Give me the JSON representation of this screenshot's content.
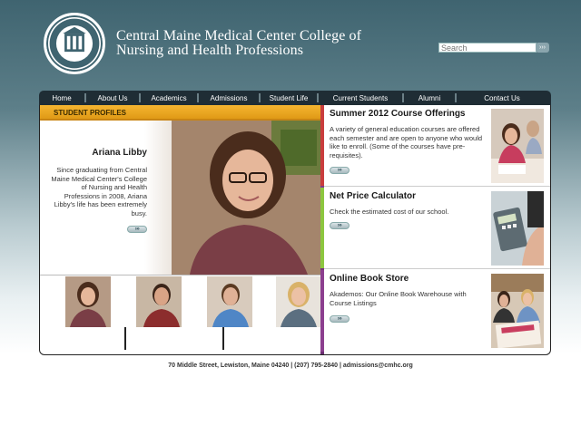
{
  "header": {
    "title_line1": "Central Maine Medical Center College of",
    "title_line2": "Nursing and Health Professions",
    "search": {
      "placeholder": "Search",
      "go_label": "›››"
    }
  },
  "nav": {
    "items": [
      "Home",
      "About Us",
      "Academics",
      "Admissions",
      "Student Life",
      "Current Students",
      "Alumni",
      "Contact Us"
    ]
  },
  "profiles": {
    "heading": "STUDENT PROFILES",
    "featured": {
      "name": "Ariana Libby",
      "text": "Since graduating from Central Maine Medical Center's College of Nursing and Health Professions in 2008, Ariana Libby's life has been extremely busy.",
      "more_label": "›››"
    }
  },
  "cards": [
    {
      "title": "Summer 2012 Course Offerings",
      "text": "A variety of general education courses are offered each semester and are open to anyone who would like to enroll.  (Some of the courses have pre-requisites).",
      "more_label": "›››",
      "accent": "#c93d3d"
    },
    {
      "title": "Net Price Calculator",
      "text": "Check the estimated cost of our school.",
      "more_label": "›››",
      "accent": "#8cc63f"
    },
    {
      "title": "Online Book Store",
      "text": "Akademos: Our Online Book Warehouse with Course Listings",
      "more_label": "›››",
      "accent": "#8c3f8f"
    }
  ],
  "footer": {
    "text": "70 Middle Street, Lewiston, Maine 04240 | (207) 795-2840 | admissions@cmhc.org"
  }
}
